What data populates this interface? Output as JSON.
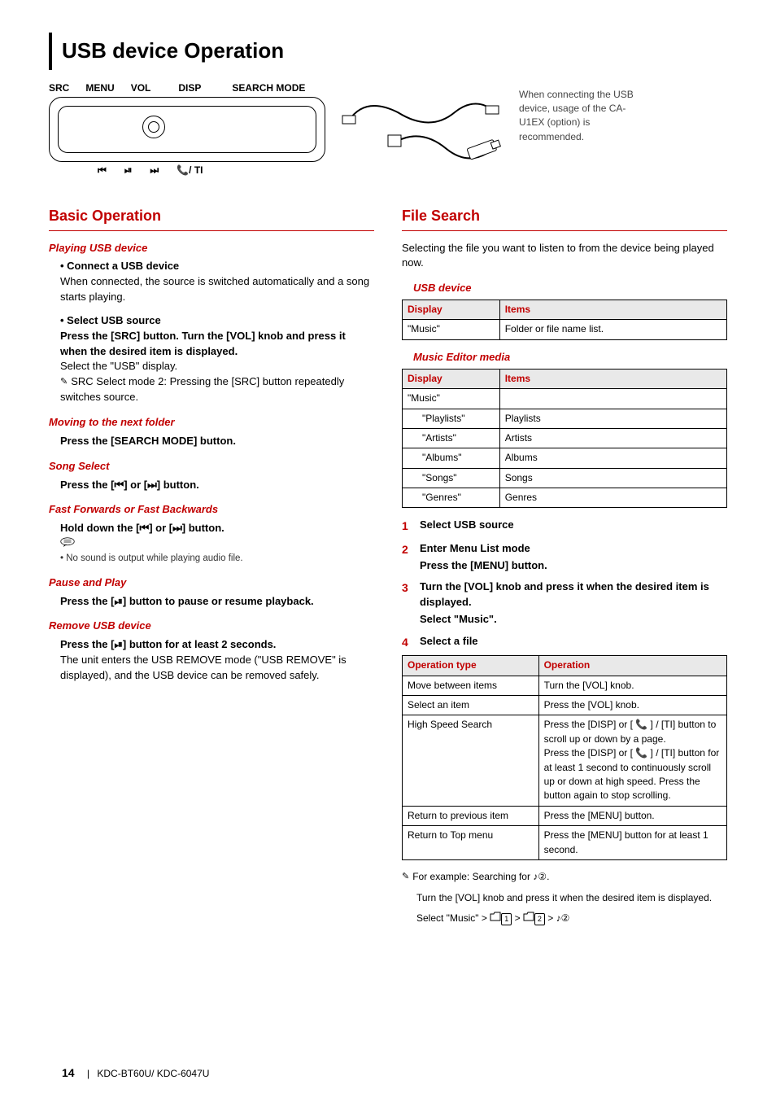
{
  "page": {
    "title": "USB device Operation",
    "footer_page": "14",
    "footer_sep": "|",
    "footer_model": "KDC-BT60U/ KDC-6047U"
  },
  "diagram": {
    "labels_top": [
      "SRC",
      "MENU",
      "VOL",
      "DISP",
      "SEARCH MODE"
    ],
    "labels_bottom": [
      "⏮",
      "⏯",
      "⏭",
      "📞/ TI"
    ],
    "connect_note": "When connecting the USB device, usage of the CA-U1EX (option) is recommended."
  },
  "left": {
    "heading": "Basic Operation",
    "playing": {
      "title": "Playing USB device",
      "bullet1_title": "• Connect a USB device",
      "bullet1_text": "When connected, the source is switched automatically and a song starts playing.",
      "bullet2_title": "• Select USB source",
      "bullet2_text1": "Press the [SRC] button. Turn the [VOL] knob and press it when the desired item is displayed.",
      "bullet2_text2": "Select the \"USB\" display.",
      "bullet2_note": "SRC Select mode 2: Pressing the [SRC] button repeatedly switches source."
    },
    "moving": {
      "title": "Moving to the next folder",
      "text": "Press the [SEARCH MODE] button."
    },
    "song": {
      "title": "Song Select",
      "text_pre": "Press the [",
      "text_mid": "] or [",
      "text_post": "] button."
    },
    "fast": {
      "title": "Fast Forwards or Fast Backwards",
      "text_pre": "Hold down the [",
      "text_mid": "] or [",
      "text_post": "] button.",
      "note": "No sound is output while playing audio file."
    },
    "pause": {
      "title": "Pause and Play",
      "text_pre": "Press the [",
      "text_post": "] button to pause or resume playback."
    },
    "remove": {
      "title": "Remove USB device",
      "text_pre": "Press the [",
      "text_post": "] button for at least 2 seconds.",
      "text2": "The unit enters the USB REMOVE mode (\"USB REMOVE\" is displayed), and the USB device can be removed safely."
    }
  },
  "right": {
    "heading": "File Search",
    "intro": "Selecting the file you want to listen to from the device being played now.",
    "usb": {
      "title": "USB device",
      "th1": "Display",
      "th2": "Items",
      "r1c1": "\"Music\"",
      "r1c2": "Folder or file name list."
    },
    "me": {
      "title": "Music Editor media",
      "th1": "Display",
      "th2": "Items",
      "r1c1": "\"Music\"",
      "r2c1": "\"Playlists\"",
      "r2c2": "Playlists",
      "r3c1": "\"Artists\"",
      "r3c2": "Artists",
      "r4c1": "\"Albums\"",
      "r4c2": "Albums",
      "r5c1": "\"Songs\"",
      "r5c2": "Songs",
      "r6c1": "\"Genres\"",
      "r6c2": "Genres"
    },
    "steps": {
      "s1_num": "1",
      "s1_title": "Select USB source",
      "s2_num": "2",
      "s2_title": "Enter Menu List mode",
      "s2_text": "Press the [MENU] button.",
      "s3_num": "3",
      "s3_title": "Turn the [VOL] knob and press it when the desired item is displayed.",
      "s3_text": "Select \"Music\".",
      "s4_num": "4",
      "s4_title": "Select a file"
    },
    "ops": {
      "th1": "Operation type",
      "th2": "Operation",
      "r1c1": "Move between items",
      "r1c2": "Turn the [VOL] knob.",
      "r2c1": "Select an item",
      "r2c2": "Press the [VOL] knob.",
      "r3c1": "High Speed Search",
      "r3c2_l1": "Press the [DISP] or [ 📞 ] / [TI] button to scroll up or down by a page.",
      "r3c2_l2": "Press the [DISP] or [ 📞 ] / [TI] button for at least 1 second to continuously scroll up or down at high speed. Press the button again to stop scrolling.",
      "r4c1": "Return to previous item",
      "r4c2": "Press the [MENU] button.",
      "r5c1": "Return to Top menu",
      "r5c2": "Press the [MENU] button for at least 1 second."
    },
    "example": {
      "line1_pre": "For example: Searching for ",
      "line1_post": ".",
      "line2": "Turn the [VOL] knob and press it when the desired item is displayed.",
      "line3_pre": "Select \"Music\" > ",
      "line3_mid": " > ",
      "folder1": "1",
      "folder2": "2",
      "music2": "②"
    }
  }
}
